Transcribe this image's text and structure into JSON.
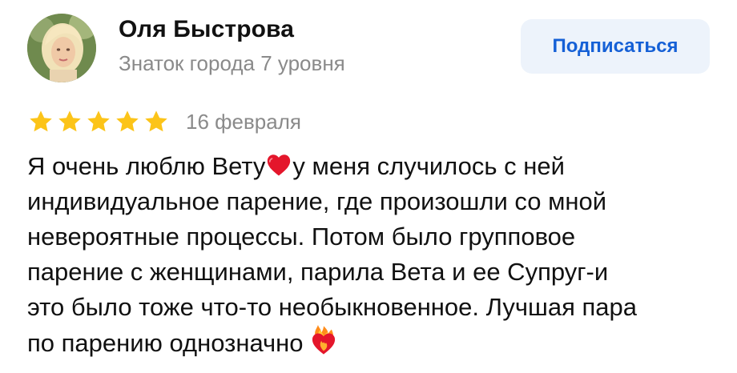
{
  "author": {
    "name": "Оля Быстрова",
    "level": "Знаток города 7 уровня"
  },
  "subscribe_label": "Подписаться",
  "rating": {
    "value": 5,
    "max": 5,
    "star_color": "#fcc419"
  },
  "date": "16 февраля",
  "review": {
    "lines": [
      {
        "before": "Я очень люблю Вету",
        "emoji": "red-heart-icon",
        "after": "у меня случилось с ней"
      },
      {
        "text": "индивидуальное парение, где произошли со мной"
      },
      {
        "text": "невероятные процессы. Потом было групповое"
      },
      {
        "text": "парение с женщинами, парила Вета и ее Супруг-и"
      },
      {
        "text": "это было тоже что-то необыкновенное. Лучшая пара"
      },
      {
        "before": "по парению однозначно ",
        "emoji": "heart-on-fire-icon"
      }
    ]
  },
  "colors": {
    "accent": "#1560d6",
    "button_bg": "#edf3fb",
    "muted_text": "#8a8a8a",
    "text": "#111111"
  }
}
